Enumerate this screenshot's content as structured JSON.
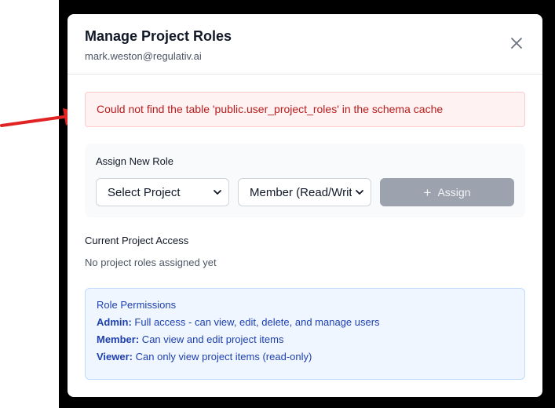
{
  "modal": {
    "title": "Manage Project Roles",
    "subtitle": "mark.weston@regulativ.ai",
    "close_icon": "close-icon"
  },
  "error": {
    "message": "Could not find the table 'public.user_project_roles' in the schema cache"
  },
  "assign": {
    "label": "Assign New Role",
    "project_select": "Select Project",
    "role_select": "Member (Read/Write)",
    "button_label": "Assign",
    "button_icon": "plus-icon"
  },
  "access": {
    "title": "Current Project Access",
    "empty": "No project roles assigned yet"
  },
  "permissions": {
    "title": "Role Permissions",
    "items": [
      {
        "role": "Admin:",
        "desc": " Full access - can view, edit, delete, and manage users"
      },
      {
        "role": "Member:",
        "desc": " Can view and edit project items"
      },
      {
        "role": "Viewer:",
        "desc": " Can only view project items (read-only)"
      }
    ]
  },
  "colors": {
    "backdrop": "#000000",
    "arrow": "#e02424",
    "error_text": "#b91c1c",
    "permissions_text": "#1e40af",
    "assign_button": "#9ca3af"
  }
}
